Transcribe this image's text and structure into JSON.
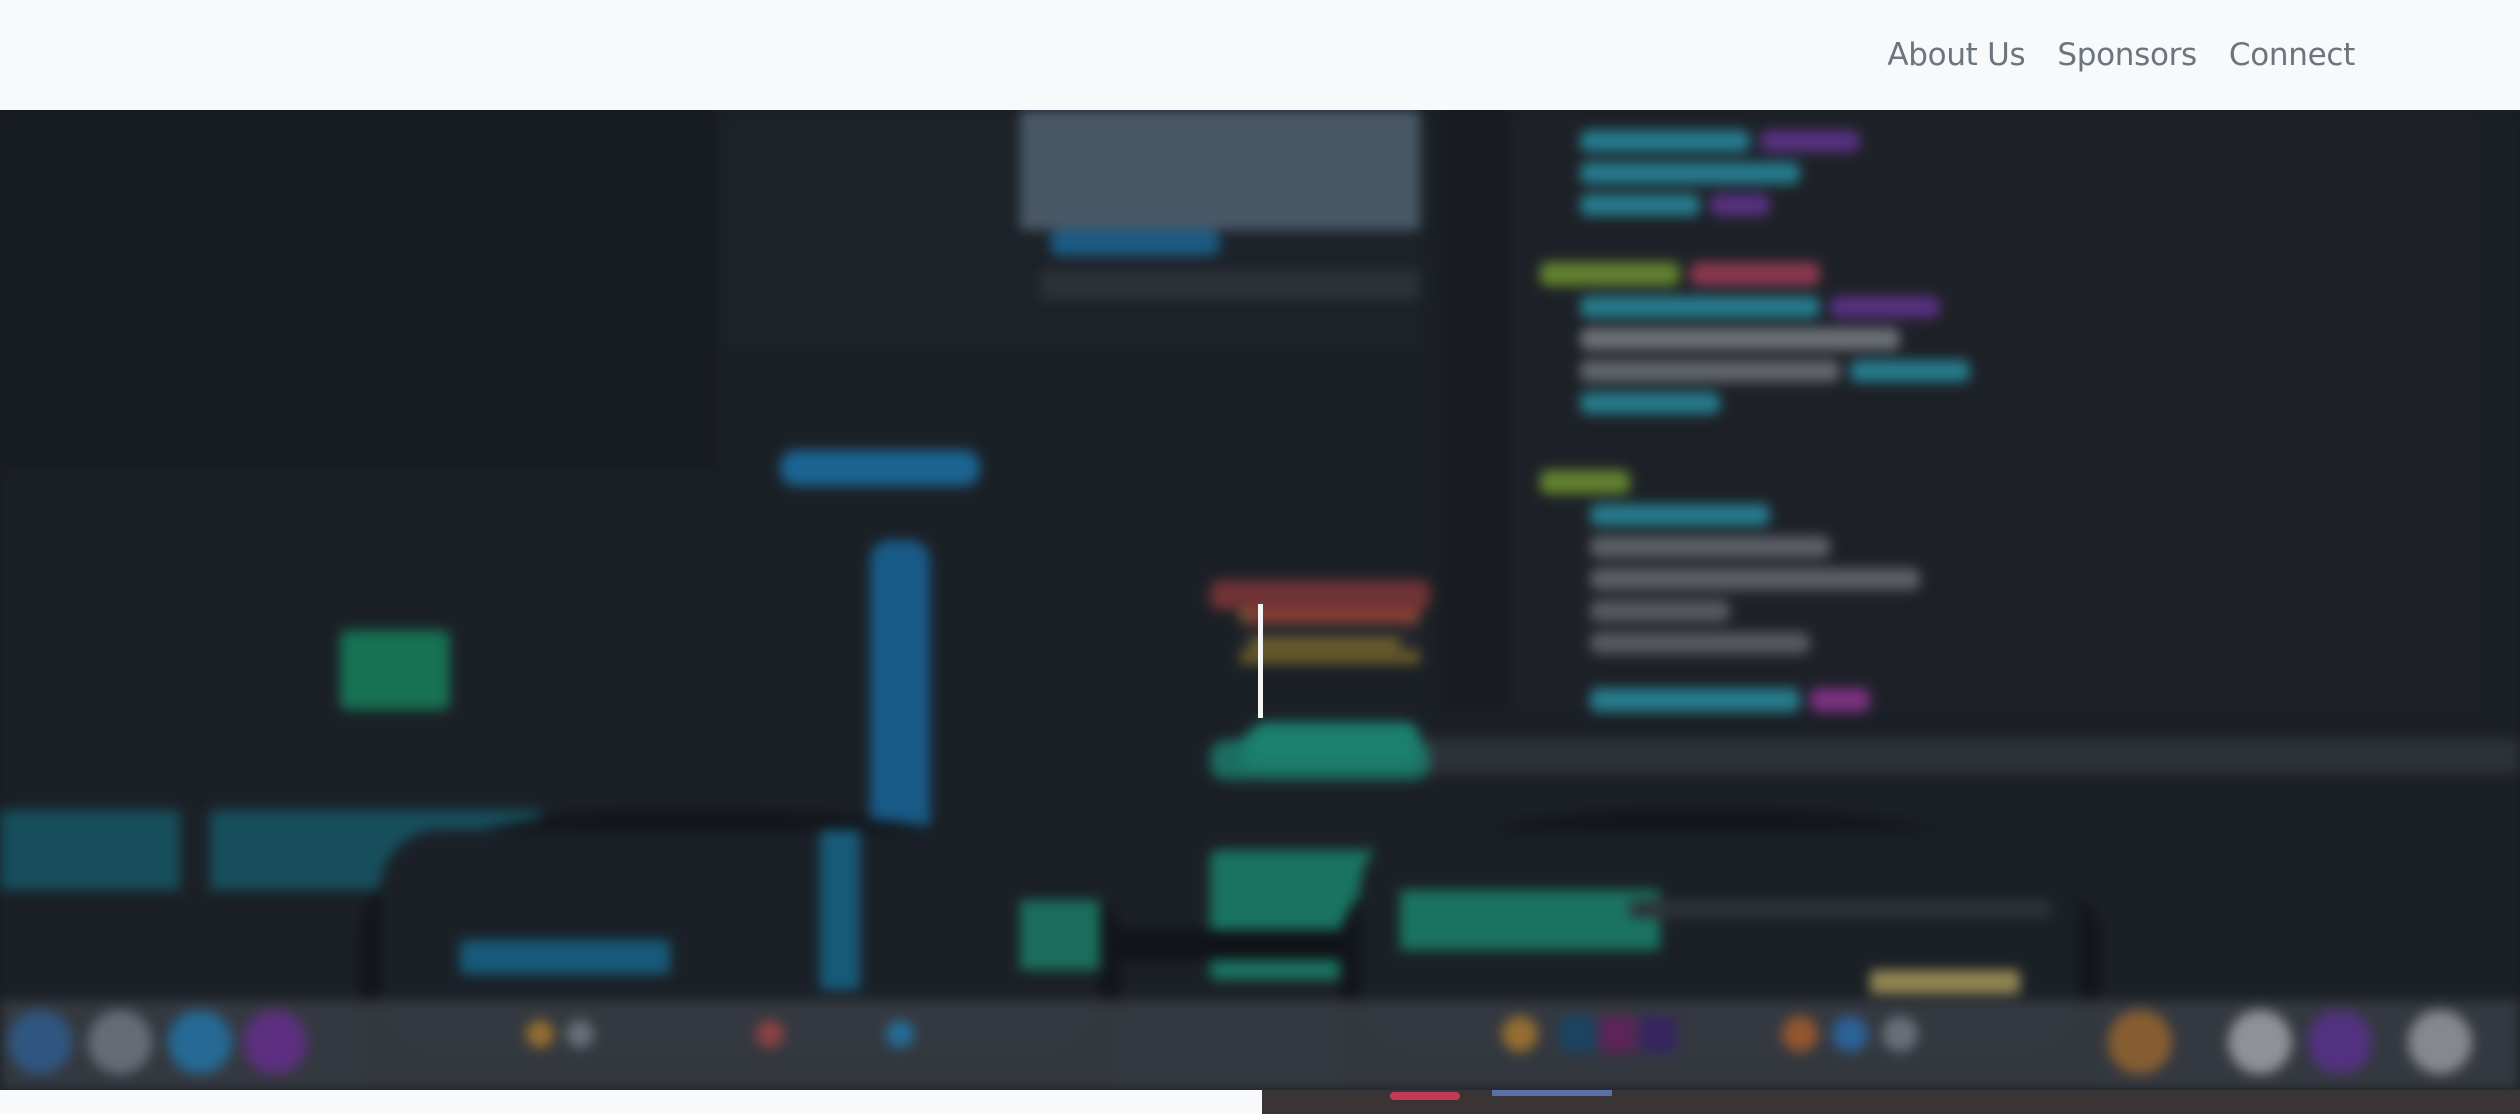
{
  "nav": {
    "links": [
      {
        "label": "About Us"
      },
      {
        "label": "Sponsors"
      },
      {
        "label": "Connect"
      }
    ]
  },
  "hero": {
    "background": "blurred photo of monitors with code editor and video timeline seen through eyeglasses",
    "text_cursor": "blinking typing cursor"
  },
  "colors": {
    "nav_background": "#f8f9fb",
    "nav_link": "#6c757d",
    "hero_dark": "#1c2127",
    "footer_dark": "#3a3434"
  }
}
